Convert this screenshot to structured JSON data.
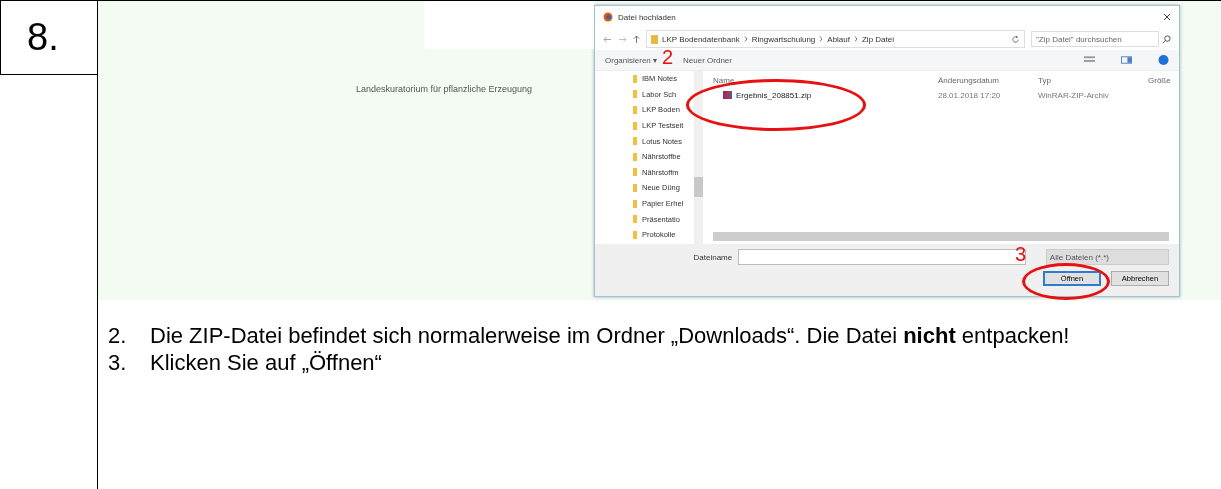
{
  "step": {
    "number": "8."
  },
  "screenshot": {
    "page_caption": "Landeskuratorium für pflanzliche Erzeugung",
    "dialog": {
      "title": "Datei hochladen",
      "breadcrumb": [
        "LKP Bodendatenbank",
        "Ringwartschulung",
        "Ablauf",
        "Zip Datei"
      ],
      "search": {
        "placeholder": "\"Zip Datei\" durchsuchen"
      },
      "toolbar": [
        "Organisieren ▾",
        "Neuer Ordner"
      ],
      "nav_folders": [
        "IBM Notes",
        "Labor Sch",
        "LKP Boden",
        "LKP Testseit",
        "Lotus Notes",
        "Nährstoffbe",
        "Nährstoffm",
        "Neue Düng",
        "Papier Erhel",
        "Präsentatio",
        "Protokolle"
      ],
      "columns": [
        "Name",
        "Änderungsdatum",
        "Typ",
        "Größe"
      ],
      "files": [
        {
          "name": "Ergebnis_208851.zip",
          "modified": "28.01.2018 17:20",
          "type": "WinRAR-ZIP-Archiv",
          "selected": false
        }
      ],
      "filename_label": "Dateiname",
      "filter": "Alle Dateien (*.*)",
      "buttons": [
        {
          "label": "Öffnen",
          "default": true
        },
        {
          "label": "Abbrechen",
          "default": false
        }
      ]
    },
    "annotations": [
      {
        "number": "2"
      },
      {
        "number": "3"
      }
    ]
  },
  "instructions": [
    {
      "number": "2.",
      "text": "Die ZIP-Datei befindet sich normalerweise im Ordner „Downloads“. Die Datei **nicht** entpacken!"
    },
    {
      "number": "3.",
      "text": "Klicken Sie auf „Öffnen“"
    }
  ]
}
